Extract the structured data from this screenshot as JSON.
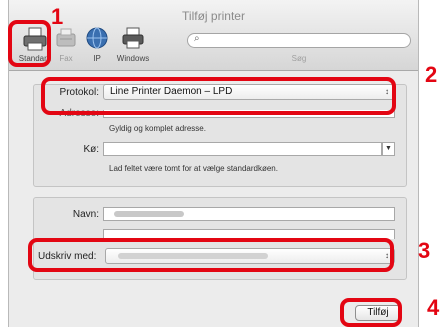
{
  "window": {
    "title": "Tilføj printer"
  },
  "toolbar": {
    "items": [
      {
        "label": "Standard",
        "icon": "standard-printer-icon"
      },
      {
        "label": "Fax",
        "icon": "fax-icon"
      },
      {
        "label": "IP",
        "icon": "ip-globe-icon"
      },
      {
        "label": "Windows",
        "icon": "windows-printer-icon"
      }
    ],
    "search_label": "Søg",
    "search_icon": "search-icon"
  },
  "form": {
    "protocol_label": "Protokol:",
    "protocol_value": "Line Printer Daemon – LPD",
    "address_label": "Adresse:",
    "address_hint": "Gyldig og komplet adresse.",
    "queue_label": "Kø:",
    "queue_hint": "Lad feltet være tomt for at vælge standardkøen.",
    "name_label": "Navn:",
    "print_with_label": "Udskriv med:"
  },
  "buttons": {
    "add": "Tilføj"
  },
  "callouts": [
    "1",
    "2",
    "3",
    "4"
  ],
  "colors": {
    "callout": "#e30613",
    "window_bg": "#ececec"
  }
}
